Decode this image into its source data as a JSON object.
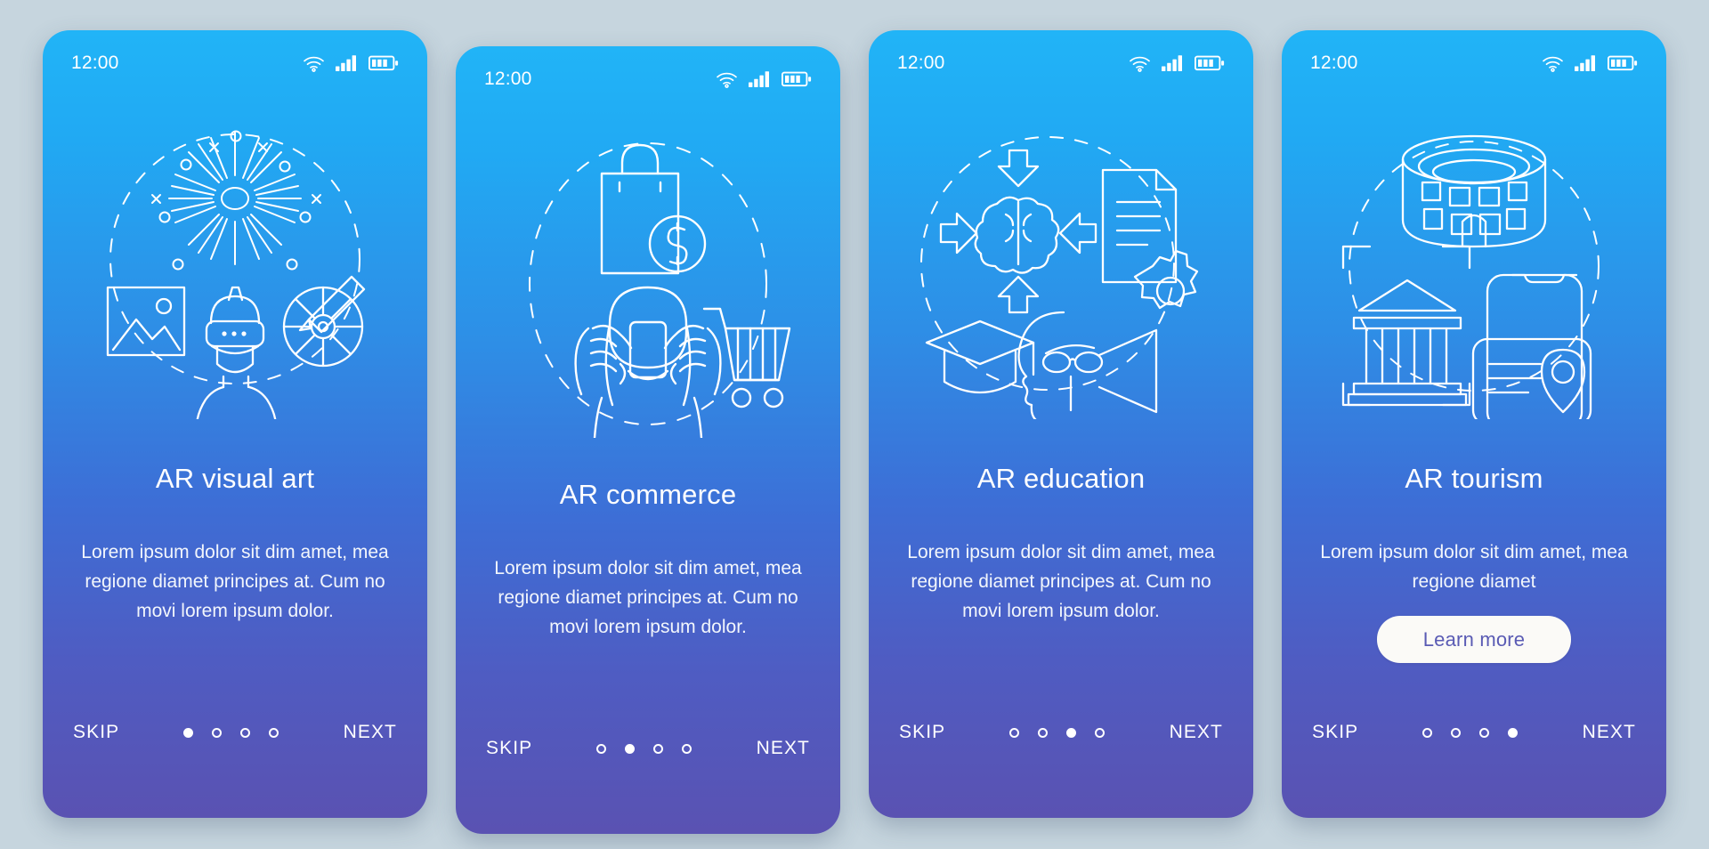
{
  "background_color": "#c6d5de",
  "card_gradient": {
    "top": "#21b4f7",
    "bottom": "#5a52b2"
  },
  "accent_button_text_color": "#5a5bb4",
  "screens": [
    {
      "status": {
        "time": "12:00",
        "wifi_icon": "wifi-icon",
        "signal_icon": "cellular-signal-icon",
        "battery_icon": "battery-icon"
      },
      "illustration": "ar-visual-art-illustration",
      "title": "AR visual art",
      "body": "Lorem ipsum dolor sit dim amet, mea regione diamet principes at. Cum no movi lorem ipsum dolor.",
      "skip_label": "SKIP",
      "next_label": "NEXT",
      "dots_total": 4,
      "dot_active": 1,
      "cta_label": null
    },
    {
      "status": {
        "time": "12:00",
        "wifi_icon": "wifi-icon",
        "signal_icon": "cellular-signal-icon",
        "battery_icon": "battery-icon"
      },
      "illustration": "ar-commerce-illustration",
      "title": "AR commerce",
      "body": "Lorem ipsum dolor sit dim amet, mea regione diamet principes at. Cum no movi lorem ipsum dolor.",
      "skip_label": "SKIP",
      "next_label": "NEXT",
      "dots_total": 4,
      "dot_active": 2,
      "cta_label": null
    },
    {
      "status": {
        "time": "12:00",
        "wifi_icon": "wifi-icon",
        "signal_icon": "cellular-signal-icon",
        "battery_icon": "battery-icon"
      },
      "illustration": "ar-education-illustration",
      "title": "AR education",
      "body": "Lorem ipsum dolor sit dim amet, mea regione diamet principes at. Cum no movi lorem ipsum dolor.",
      "skip_label": "SKIP",
      "next_label": "NEXT",
      "dots_total": 4,
      "dot_active": 3,
      "cta_label": null
    },
    {
      "status": {
        "time": "12:00",
        "wifi_icon": "wifi-icon",
        "signal_icon": "cellular-signal-icon",
        "battery_icon": "battery-icon"
      },
      "illustration": "ar-tourism-illustration",
      "title": "AR tourism",
      "body": "Lorem ipsum dolor sit dim amet, mea regione diamet",
      "skip_label": "SKIP",
      "next_label": "NEXT",
      "dots_total": 4,
      "dot_active": 4,
      "cta_label": "Learn more"
    }
  ]
}
